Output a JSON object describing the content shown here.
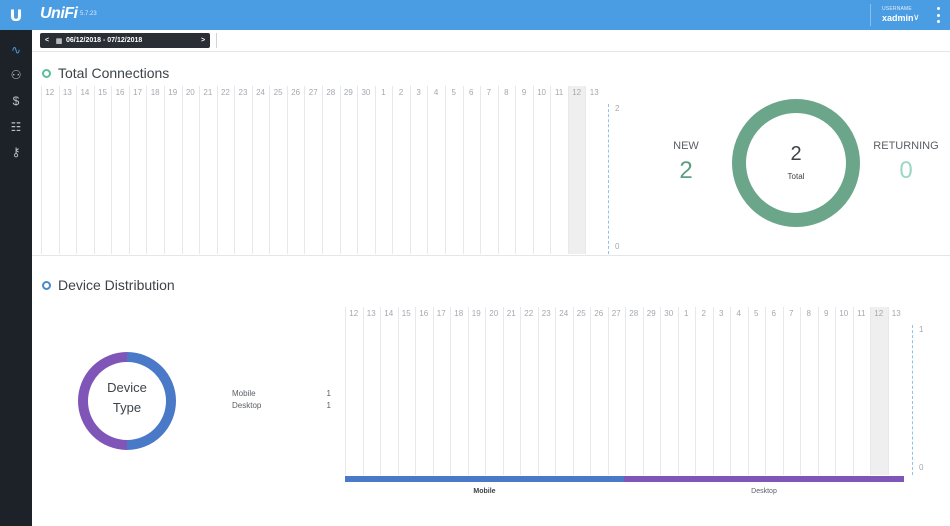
{
  "header": {
    "logo_glyph": "U",
    "brand": "UniFi",
    "version": "5.7.23",
    "user_caption": "USERNAME",
    "username": "xadmin",
    "chevron": "∨"
  },
  "sidebar": {
    "items": [
      {
        "icon": "statistics-icon",
        "glyph": "∿",
        "active": true
      },
      {
        "icon": "users-icon",
        "glyph": "⚇"
      },
      {
        "icon": "dollar-icon",
        "glyph": "$"
      },
      {
        "icon": "receipt-icon",
        "glyph": "☷"
      },
      {
        "icon": "key-icon",
        "glyph": "⚷"
      }
    ]
  },
  "toolbar": {
    "prev": "<",
    "next": ">",
    "calendar_glyph": "▦",
    "date_range": "06/12/2018 - 07/12/2018"
  },
  "total_connections": {
    "title": "Total Connections",
    "days": [
      "12",
      "13",
      "14",
      "15",
      "16",
      "17",
      "18",
      "19",
      "20",
      "21",
      "22",
      "23",
      "24",
      "25",
      "26",
      "27",
      "28",
      "29",
      "30",
      "1",
      "2",
      "3",
      "4",
      "5",
      "6",
      "7",
      "8",
      "9",
      "10",
      "11",
      "12",
      "13"
    ],
    "highlight_index": 30,
    "axis_max": "2",
    "axis_min": "0",
    "new_label": "NEW",
    "new_value": "2",
    "returning_label": "RETURNING",
    "returning_value": "0",
    "total_value": "2",
    "total_label": "Total",
    "colors": {
      "ring": "#6ba58a",
      "new": "#5e9e80",
      "returning": "#9cd8c1"
    }
  },
  "device_distribution": {
    "title": "Device Distribution",
    "donut_label_line1": "Device",
    "donut_label_line2": "Type",
    "legend": [
      {
        "name": "Mobile",
        "value": "1"
      },
      {
        "name": "Desktop",
        "value": "1"
      }
    ],
    "days": [
      "12",
      "13",
      "14",
      "15",
      "16",
      "17",
      "18",
      "19",
      "20",
      "21",
      "22",
      "23",
      "24",
      "25",
      "26",
      "27",
      "28",
      "29",
      "30",
      "1",
      "2",
      "3",
      "4",
      "5",
      "6",
      "7",
      "8",
      "9",
      "10",
      "11",
      "12",
      "13"
    ],
    "highlight_index": 30,
    "axis_max": "1",
    "axis_min": "0",
    "bar_mobile_label": "Mobile",
    "bar_desktop_label": "Desktop",
    "colors": {
      "mobile": "#4a79c8",
      "desktop": "#8055b8"
    }
  }
}
